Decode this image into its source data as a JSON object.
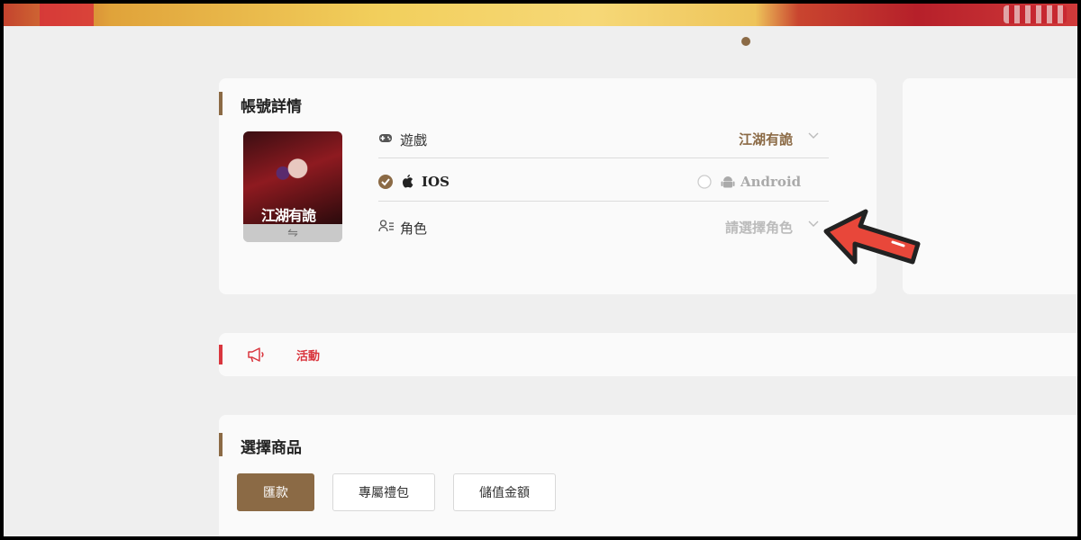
{
  "account": {
    "title": "帳號詳情",
    "game_label": "遊戲",
    "game_value": "江湖有詭",
    "platform_ios": "IOS",
    "platform_android": "Android",
    "role_label": "角色",
    "role_placeholder": "請選擇角色",
    "thumb_logo_text": "江湖有詭",
    "switch_icon": "⇋"
  },
  "activity": {
    "label": "活動"
  },
  "products": {
    "title": "選擇商品",
    "tabs": [
      "匯款",
      "專屬禮包",
      "儲值金額"
    ]
  },
  "colors": {
    "accent": "#8b6a45",
    "activity_red": "#d9363e"
  }
}
